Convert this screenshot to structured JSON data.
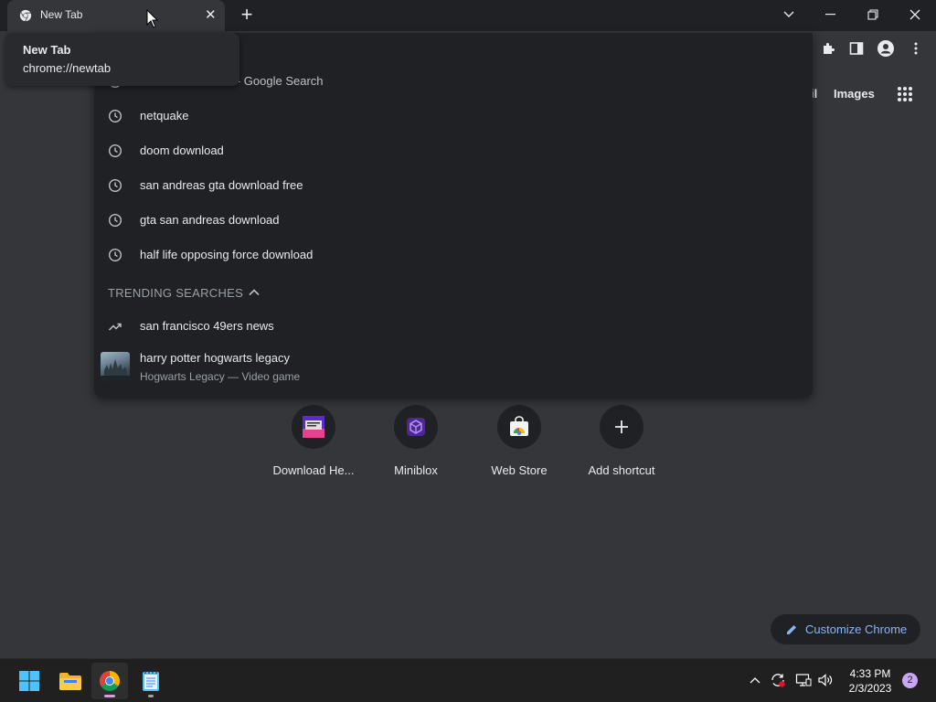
{
  "tab": {
    "title": "New Tab",
    "close": "✕"
  },
  "newtab_button": "+",
  "hovercard": {
    "title": "New Tab",
    "url": "chrome://newtab"
  },
  "header_links": {
    "gmail_partial": "il",
    "images": "Images"
  },
  "omnibox": {
    "suggestions": [
      {
        "text": "e - Google Search",
        "icon": "clock-icon"
      },
      {
        "text": "netquake",
        "icon": "clock-icon"
      },
      {
        "text": "doom download",
        "icon": "clock-icon"
      },
      {
        "text": "san andreas gta download free",
        "icon": "clock-icon"
      },
      {
        "text": "gta san andreas download",
        "icon": "clock-icon"
      },
      {
        "text": "half life opposing force download",
        "icon": "clock-icon"
      }
    ],
    "trending_header": "TRENDING SEARCHES",
    "trending": [
      {
        "text": "san francisco 49ers news",
        "icon": "trending-icon"
      }
    ],
    "entity": {
      "title": "harry potter hogwarts legacy",
      "subtitle": "Hogwarts Legacy — Video game"
    }
  },
  "shortcuts": [
    {
      "label": "Download He...",
      "icon": "download-heroes-icon"
    },
    {
      "label": "Miniblox",
      "icon": "miniblox-icon"
    },
    {
      "label": "Web Store",
      "icon": "web-store-icon"
    },
    {
      "label": "Add shortcut",
      "icon": "plus-icon"
    }
  ],
  "customize": {
    "label": "Customize Chrome"
  },
  "taskbar": {
    "time": "4:33 PM",
    "date": "2/3/2023",
    "notifications": "2"
  },
  "colors": {
    "background": "#35363a",
    "dropdown": "#202124",
    "accent": "#8ab4f8"
  }
}
